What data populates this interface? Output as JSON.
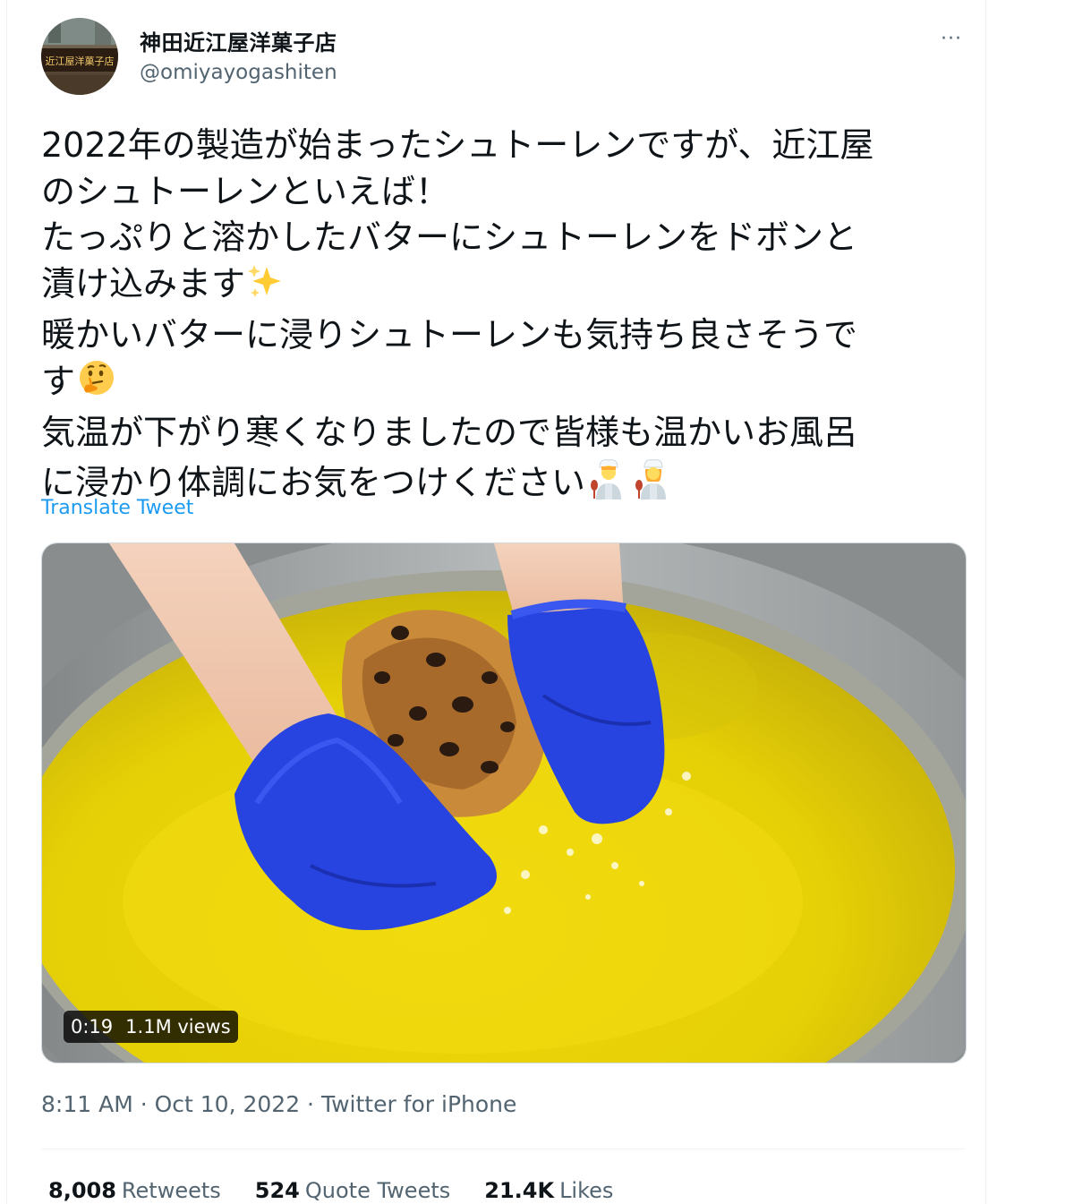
{
  "user": {
    "display_name": "神田近江屋洋菓子店",
    "handle": "@omiyayogashiten",
    "avatar_text": "近江屋洋菓子店"
  },
  "more_label": "···",
  "tweet": {
    "lines": [
      "2022年の製造が始まったシュトーレンですが、近江屋",
      "のシュトーレンといえば！",
      "たっぷりと溶かしたバターにシュトーレンをドボンと",
      "漬け込みます",
      "暖かいバターに浸りシュトーレンも気持ち良さそうで",
      "す",
      "気温が下がり寒くなりましたので皆様も温かいお風呂",
      "に浸かり体調にお気をつけください"
    ],
    "emojis": {
      "line_4": "sparkles-icon",
      "line_6": "thinking-face-icon",
      "line_8": [
        "man-cook-icon",
        "woman-cook-icon"
      ]
    }
  },
  "translate_label": "Translate Tweet",
  "video": {
    "duration": "0:19",
    "views": "1.1M views"
  },
  "meta": "8:11 AM · Oct 10, 2022 · Twitter for iPhone",
  "stats": [
    {
      "count": "8,008",
      "label": "Retweets"
    },
    {
      "count": "524",
      "label": "Quote Tweets"
    },
    {
      "count": "21.4K",
      "label": "Likes"
    }
  ],
  "colors": {
    "link": "#1d9bf0",
    "secondary_text": "#536471",
    "butter": "#e6d300",
    "glove": "#2743e0"
  }
}
